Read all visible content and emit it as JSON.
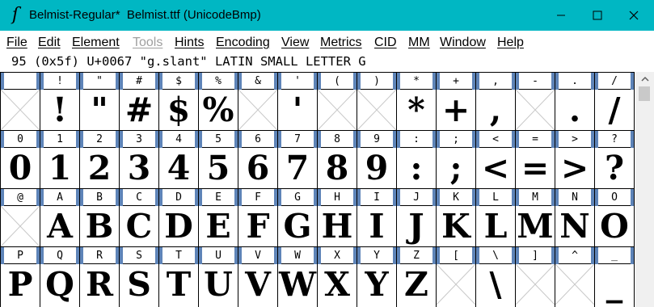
{
  "window": {
    "title": "Belmist-Regular*  Belmist.ttf (UnicodeBmp)",
    "app_icon": "fontforge-icon",
    "accent_color": "#00b7c3"
  },
  "menu": [
    {
      "label": "File",
      "enabled": true
    },
    {
      "label": "Edit",
      "enabled": true
    },
    {
      "label": "Element",
      "enabled": true
    },
    {
      "label": "Tools",
      "enabled": false
    },
    {
      "label": "Hints",
      "enabled": true
    },
    {
      "label": "Encoding",
      "enabled": true
    },
    {
      "label": "View",
      "enabled": true
    },
    {
      "label": "Metrics",
      "enabled": true
    },
    {
      "label": "CID",
      "enabled": true
    },
    {
      "label": "MM",
      "enabled": true
    },
    {
      "label": "Window",
      "enabled": true
    },
    {
      "label": "Help",
      "enabled": true
    }
  ],
  "info": "95 (0x5f) U+0067 \"g.slant\" LATIN SMALL LETTER G",
  "rows": [
    {
      "labels": [
        " ",
        "!",
        "\"",
        "#",
        "$",
        "%",
        "&",
        "'",
        "(",
        ")",
        "*",
        "+",
        ",",
        "-",
        ".",
        "/"
      ],
      "glyphs": [
        "",
        "!",
        "\"",
        "#",
        "$",
        "%",
        "",
        "'",
        "",
        "",
        "*",
        "+",
        ",",
        "",
        ".",
        "/"
      ]
    },
    {
      "labels": [
        "0",
        "1",
        "2",
        "3",
        "4",
        "5",
        "6",
        "7",
        "8",
        "9",
        ":",
        ";",
        "<",
        "=",
        ">",
        "?"
      ],
      "glyphs": [
        "0",
        "1",
        "2",
        "3",
        "4",
        "5",
        "6",
        "7",
        "8",
        "9",
        ":",
        ";",
        "<",
        "=",
        ">",
        "?"
      ]
    },
    {
      "labels": [
        "@",
        "A",
        "B",
        "C",
        "D",
        "E",
        "F",
        "G",
        "H",
        "I",
        "J",
        "K",
        "L",
        "M",
        "N",
        "O"
      ],
      "glyphs": [
        "",
        "A",
        "B",
        "C",
        "D",
        "E",
        "F",
        "G",
        "H",
        "I",
        "J",
        "K",
        "L",
        "M",
        "N",
        "O"
      ]
    },
    {
      "labels": [
        "P",
        "Q",
        "R",
        "S",
        "T",
        "U",
        "V",
        "W",
        "X",
        "Y",
        "Z",
        "[",
        "\\",
        "]",
        "^",
        "_"
      ],
      "glyphs": [
        "P",
        "Q",
        "R",
        "S",
        "T",
        "U",
        "V",
        "W",
        "X",
        "Y",
        "Z",
        "",
        "\\",
        "",
        "",
        "_"
      ]
    }
  ]
}
